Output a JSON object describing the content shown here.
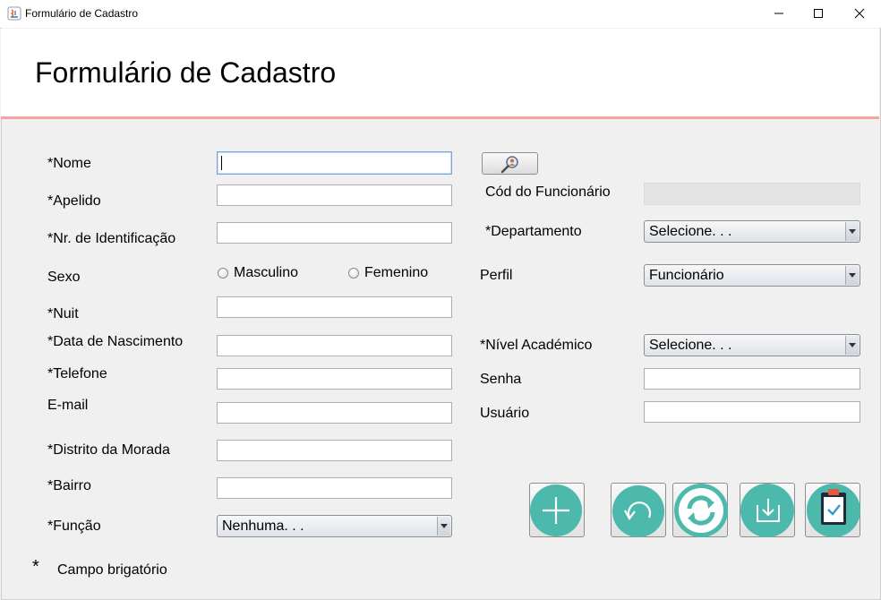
{
  "window": {
    "title": "Formulário de Cadastro"
  },
  "header": {
    "title": "Formulário de Cadastro"
  },
  "form_left": {
    "nome_label": "*Nome",
    "apelido_label": "*Apelido",
    "nr_identificacao_label": "*Nr. de Identificação",
    "sexo_label": "Sexo",
    "sexo_options": [
      "Masculino",
      "Femenino"
    ],
    "nuit_label": "*Nuit",
    "data_nascimento_label": "*Data de Nascimento",
    "telefone_label": "*Telefone",
    "email_label": "E-mail",
    "distrito_label": "*Distrito da Morada",
    "bairro_label": "*Bairro",
    "funcao_label": "*Função",
    "funcao_value": "Nenhuma. . ."
  },
  "form_right": {
    "cod_funcionario_label": "Cód do Funcionário",
    "departamento_label": "*Departamento",
    "departamento_value": "Selecione. . .",
    "perfil_label": "Perfil",
    "perfil_value": "Funcionário",
    "nivel_academico_label": "*Nível Académico",
    "nivel_academico_value": "Selecione. . .",
    "senha_label": "Senha",
    "usuario_label": "Usuário"
  },
  "footer": {
    "star": "*",
    "note": "Campo brigatório"
  },
  "icons": {
    "search": "search-user-icon",
    "add": "plus-icon",
    "undo": "undo-icon",
    "refresh": "refresh-icon",
    "save": "download-icon",
    "report": "clipboard-check-icon"
  },
  "colors": {
    "accent": "#4cb9ac",
    "header_line": "#f4a3a0"
  }
}
